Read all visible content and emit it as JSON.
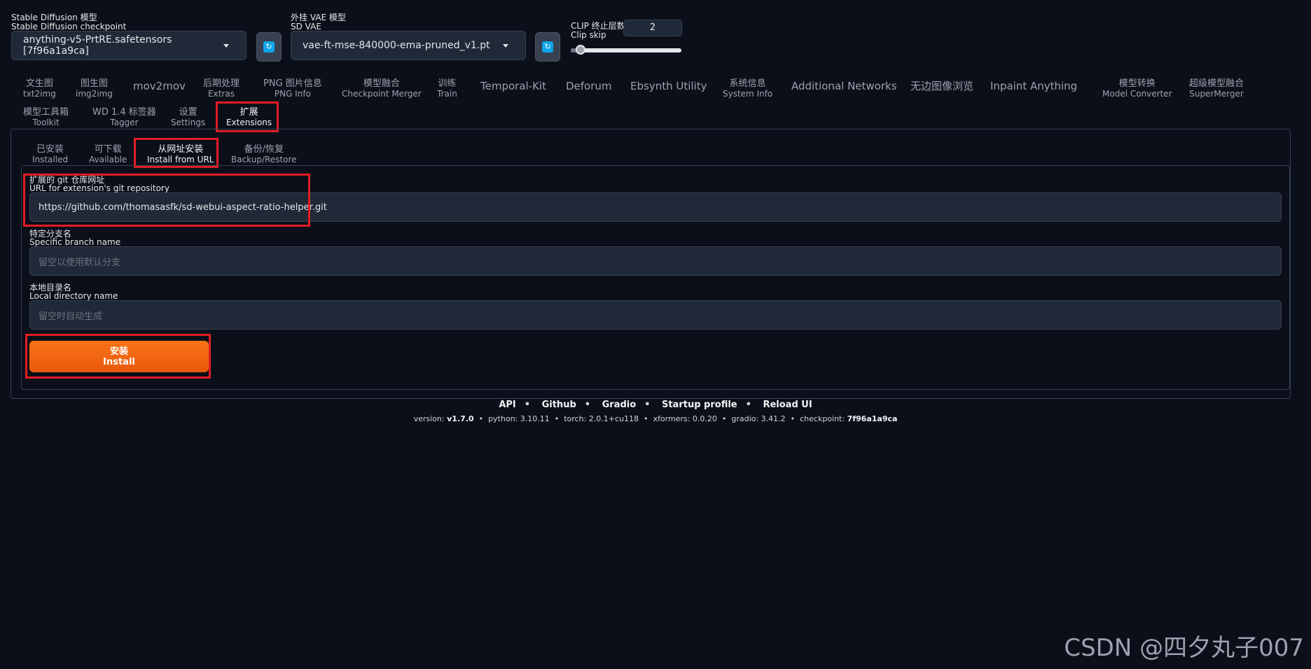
{
  "top": {
    "checkpoint": {
      "label_zh": "Stable Diffusion 模型",
      "label_en": "Stable Diffusion checkpoint",
      "value": "anything-v5-PrtRE.safetensors [7f96a1a9ca]"
    },
    "vae": {
      "label_zh": "外挂 VAE 模型",
      "label_en": "SD VAE",
      "value": "vae-ft-mse-840000-ema-pruned_v1.pt"
    },
    "clip": {
      "label_zh": "CLIP 终止层数",
      "label_en": "Clip skip",
      "value": "2",
      "slider_fraction": 0.08
    }
  },
  "tabs": [
    {
      "zh": "文生图",
      "en": "txt2img"
    },
    {
      "zh": "图生图",
      "en": "img2img"
    },
    {
      "single": "mov2mov"
    },
    {
      "zh": "后期处理",
      "en": "Extras"
    },
    {
      "zh": "PNG 图片信息",
      "en": "PNG Info"
    },
    {
      "zh": "模型融合",
      "en": "Checkpoint Merger"
    },
    {
      "zh": "训练",
      "en": "Train"
    },
    {
      "single": "Temporal-Kit"
    },
    {
      "single": "Deforum"
    },
    {
      "single": "Ebsynth Utility"
    },
    {
      "zh": "系统信息",
      "en": "System Info"
    },
    {
      "single": "Additional Networks"
    },
    {
      "single": "无边图像浏览"
    },
    {
      "single": "Inpaint Anything"
    },
    {
      "zh": "模型转换",
      "en": "Model Converter"
    },
    {
      "zh": "超级模型融合",
      "en": "SuperMerger"
    },
    {
      "zh": "模型工具箱",
      "en": "Toolkit"
    },
    {
      "zh": "WD 1.4 标签器",
      "en": "Tagger"
    },
    {
      "zh": "设置",
      "en": "Settings"
    },
    {
      "zh": "扩展",
      "en": "Extensions"
    }
  ],
  "subtabs": [
    {
      "zh": "已安装",
      "en": "Installed"
    },
    {
      "zh": "可下载",
      "en": "Available"
    },
    {
      "zh": "从网址安装",
      "en": "Install from URL"
    },
    {
      "zh": "备份/恢复",
      "en": "Backup/Restore"
    }
  ],
  "form": {
    "url": {
      "label_zh": "扩展的 git 仓库网址",
      "label_en": "URL for extension's git repository",
      "value": "https://github.com/thomasasfk/sd-webui-aspect-ratio-helper.git"
    },
    "branch": {
      "label_zh": "特定分支名",
      "label_en": "Specific branch name",
      "placeholder": "留空以使用默认分支"
    },
    "dir": {
      "label_zh": "本地目录名",
      "label_en": "Local directory name",
      "placeholder": "留空时自动生成"
    },
    "install": {
      "zh": "安装",
      "en": "Install"
    }
  },
  "footer": {
    "links": [
      "API",
      "Github",
      "Gradio",
      "Startup profile",
      "Reload UI"
    ],
    "version": {
      "version_label": "version:",
      "version": "v1.7.0",
      "python_label": "python:",
      "python": "3.10.11",
      "torch_label": "torch:",
      "torch": "2.0.1+cu118",
      "xformers_label": "xformers:",
      "xformers": "0.0.20",
      "gradio_label": "gradio:",
      "gradio": "3.41.2",
      "checkpoint_label": "checkpoint:",
      "checkpoint": "7f96a1a9ca"
    }
  },
  "watermark": "CSDN @四夕丸子007",
  "icons": {
    "refresh": "refresh-icon",
    "caret": "chevron-down-icon"
  }
}
